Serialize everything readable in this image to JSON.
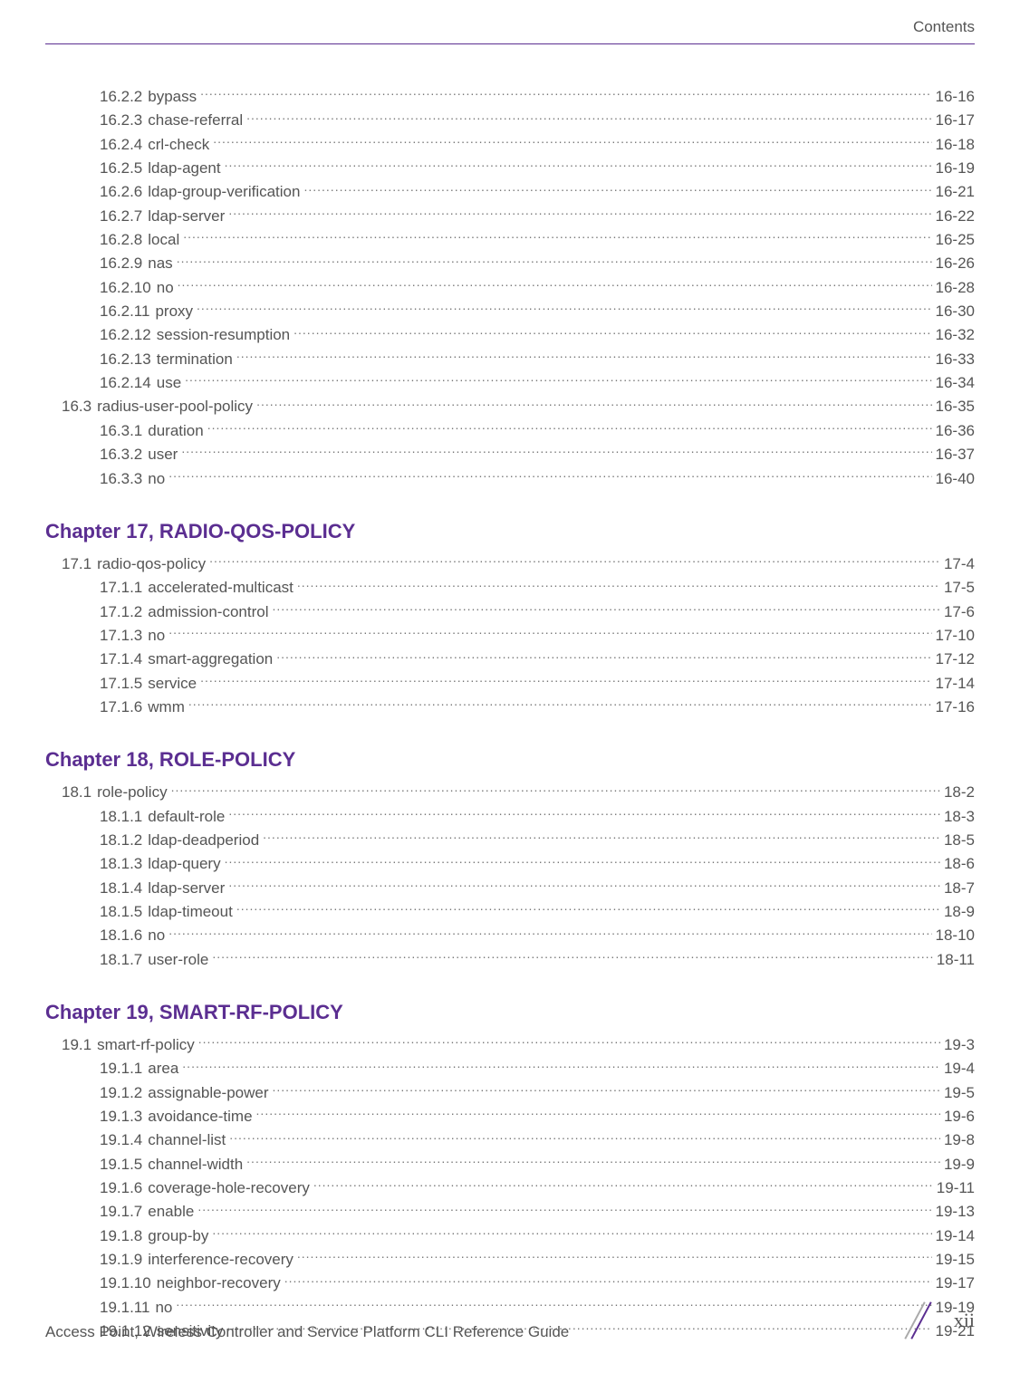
{
  "header": {
    "label": "Contents"
  },
  "footer": {
    "guide_title": "Access Point, Wireless Controller and Service Platform CLI Reference Guide",
    "page_num": "xii"
  },
  "chapters": [
    {
      "heading": "",
      "entries": [
        {
          "indent": 2,
          "num": "16.2.2",
          "title": "bypass",
          "page": "16-16"
        },
        {
          "indent": 2,
          "num": "16.2.3",
          "title": "chase-referral",
          "page": "16-17"
        },
        {
          "indent": 2,
          "num": "16.2.4",
          "title": "crl-check",
          "page": "16-18"
        },
        {
          "indent": 2,
          "num": "16.2.5",
          "title": "ldap-agent",
          "page": "16-19"
        },
        {
          "indent": 2,
          "num": "16.2.6",
          "title": "ldap-group-verification",
          "page": "16-21"
        },
        {
          "indent": 2,
          "num": "16.2.7",
          "title": "ldap-server",
          "page": "16-22"
        },
        {
          "indent": 2,
          "num": "16.2.8",
          "title": "local",
          "page": "16-25"
        },
        {
          "indent": 2,
          "num": "16.2.9",
          "title": "nas",
          "page": "16-26"
        },
        {
          "indent": 2,
          "num": "16.2.10",
          "title": "no",
          "page": "16-28"
        },
        {
          "indent": 2,
          "num": "16.2.11",
          "title": "proxy",
          "page": "16-30"
        },
        {
          "indent": 2,
          "num": "16.2.12",
          "title": "session-resumption",
          "page": "16-32"
        },
        {
          "indent": 2,
          "num": "16.2.13",
          "title": "termination",
          "page": "16-33"
        },
        {
          "indent": 2,
          "num": "16.2.14",
          "title": "use",
          "page": "16-34"
        },
        {
          "indent": 1,
          "num": "16.3",
          "title": "radius-user-pool-policy",
          "page": "16-35"
        },
        {
          "indent": 2,
          "num": "16.3.1",
          "title": "duration",
          "page": "16-36"
        },
        {
          "indent": 2,
          "num": "16.3.2",
          "title": "user",
          "page": "16-37"
        },
        {
          "indent": 2,
          "num": "16.3.3",
          "title": "no",
          "page": "16-40"
        }
      ]
    },
    {
      "heading": "Chapter 17, RADIO-QOS-POLICY",
      "entries": [
        {
          "indent": 1,
          "num": "17.1",
          "title": "radio-qos-policy",
          "page": "17-4"
        },
        {
          "indent": 2,
          "num": "17.1.1",
          "title": "accelerated-multicast",
          "page": "17-5"
        },
        {
          "indent": 2,
          "num": "17.1.2",
          "title": "admission-control",
          "page": "17-6"
        },
        {
          "indent": 2,
          "num": "17.1.3",
          "title": "no",
          "page": "17-10"
        },
        {
          "indent": 2,
          "num": "17.1.4",
          "title": "smart-aggregation",
          "page": "17-12"
        },
        {
          "indent": 2,
          "num": "17.1.5",
          "title": "service",
          "page": "17-14"
        },
        {
          "indent": 2,
          "num": "17.1.6",
          "title": "wmm",
          "page": "17-16"
        }
      ]
    },
    {
      "heading": "Chapter 18, ROLE-POLICY",
      "entries": [
        {
          "indent": 1,
          "num": "18.1",
          "title": "role-policy",
          "page": "18-2"
        },
        {
          "indent": 2,
          "num": "18.1.1",
          "title": "default-role",
          "page": "18-3"
        },
        {
          "indent": 2,
          "num": "18.1.2",
          "title": "ldap-deadperiod",
          "page": "18-5"
        },
        {
          "indent": 2,
          "num": "18.1.3",
          "title": "ldap-query",
          "page": "18-6"
        },
        {
          "indent": 2,
          "num": "18.1.4",
          "title": "ldap-server",
          "page": "18-7"
        },
        {
          "indent": 2,
          "num": "18.1.5",
          "title": "ldap-timeout",
          "page": "18-9"
        },
        {
          "indent": 2,
          "num": "18.1.6",
          "title": "no",
          "page": "18-10"
        },
        {
          "indent": 2,
          "num": "18.1.7",
          "title": "user-role",
          "page": "18-11"
        }
      ]
    },
    {
      "heading": "Chapter 19, SMART-RF-POLICY",
      "entries": [
        {
          "indent": 1,
          "num": "19.1",
          "title": "smart-rf-policy",
          "page": "19-3"
        },
        {
          "indent": 2,
          "num": "19.1.1",
          "title": "area",
          "page": "19-4"
        },
        {
          "indent": 2,
          "num": "19.1.2",
          "title": "assignable-power",
          "page": "19-5"
        },
        {
          "indent": 2,
          "num": "19.1.3",
          "title": "avoidance-time",
          "page": "19-6"
        },
        {
          "indent": 2,
          "num": "19.1.4",
          "title": "channel-list",
          "page": "19-8"
        },
        {
          "indent": 2,
          "num": "19.1.5",
          "title": "channel-width",
          "page": "19-9"
        },
        {
          "indent": 2,
          "num": "19.1.6",
          "title": "coverage-hole-recovery",
          "page": "19-11"
        },
        {
          "indent": 2,
          "num": "19.1.7",
          "title": "enable",
          "page": "19-13"
        },
        {
          "indent": 2,
          "num": "19.1.8",
          "title": "group-by",
          "page": "19-14"
        },
        {
          "indent": 2,
          "num": "19.1.9",
          "title": "interference-recovery",
          "page": "19-15"
        },
        {
          "indent": 2,
          "num": "19.1.10",
          "title": "neighbor-recovery",
          "page": "19-17"
        },
        {
          "indent": 2,
          "num": "19.1.11",
          "title": "no",
          "page": "19-19"
        },
        {
          "indent": 2,
          "num": "19.1.12",
          "title": "sensitivity",
          "page": "19-21"
        }
      ]
    }
  ]
}
